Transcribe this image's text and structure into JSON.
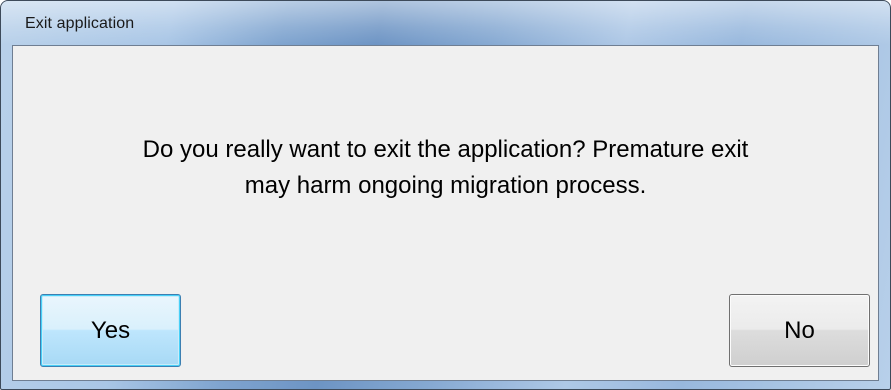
{
  "window": {
    "title": "Exit application"
  },
  "dialog": {
    "message_line1": "Do you really want to exit the application? Premature exit",
    "message_line2": "may harm ongoing migration process."
  },
  "buttons": {
    "yes_label": "Yes",
    "no_label": "No"
  },
  "colors": {
    "client_background": "#f0f0f0",
    "focused_button_border": "#3c7fb1",
    "title_bar_accent": "#7fa4cf"
  }
}
